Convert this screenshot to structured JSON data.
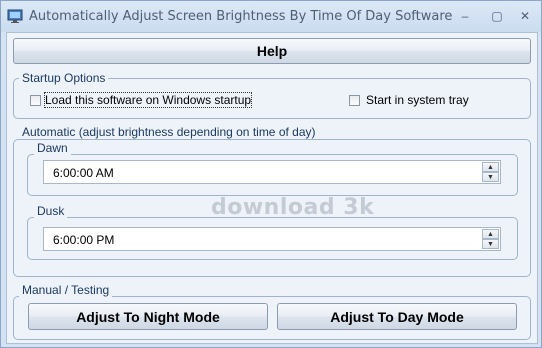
{
  "window": {
    "title": "Automatically Adjust Screen Brightness By Time Of Day Software",
    "controls": {
      "minimize": "–",
      "maximize": "▢",
      "close": "✕"
    }
  },
  "help_button": {
    "label": "Help"
  },
  "startup_options": {
    "label": "Startup Options",
    "load_on_startup": {
      "label": "Load this software on Windows startup",
      "checked": false
    },
    "start_in_tray": {
      "label": "Start in system tray",
      "checked": false
    }
  },
  "automatic": {
    "label": "Automatic (adjust brightness depending on time of day)",
    "dawn": {
      "label": "Dawn",
      "value": "6:00:00 AM"
    },
    "dusk": {
      "label": "Dusk",
      "value": "6:00:00 PM"
    }
  },
  "manual": {
    "label": "Manual / Testing",
    "night_button": "Adjust To Night Mode",
    "day_button": "Adjust To Day Mode"
  },
  "watermark": "download 3k",
  "icons": [
    "app-icon",
    "minimize-icon",
    "maximize-icon",
    "close-icon",
    "spin-up-icon",
    "spin-down-icon"
  ]
}
